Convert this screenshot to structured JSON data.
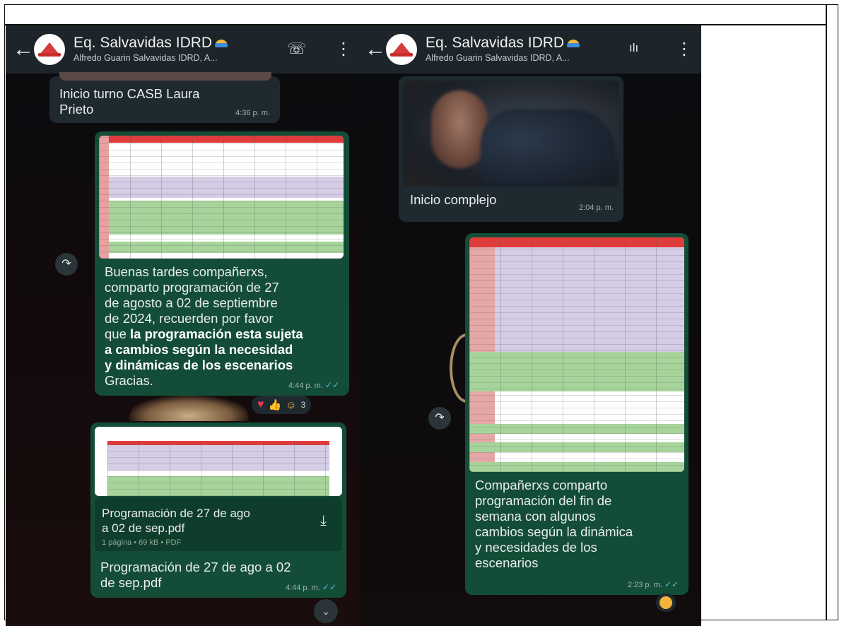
{
  "chat": {
    "group_name": "Eq. Salvavidas IDRD",
    "group_subtitle": "Alfredo Guarin Salvavidas IDRD, A..."
  },
  "left_panel": {
    "msg_turno": {
      "text_line1": "Inicio turno CASB Laura",
      "text_line2": "Prieto",
      "time": "4:36 p. m."
    },
    "msg_programacion": {
      "line1": "Buenas tardes compañerxs,",
      "line2": "comparto programación de 27",
      "line3": "de agosto a 02 de septiembre",
      "line4": "de 2024, recuerden por favor",
      "line5_plain": "que ",
      "line5_bold": "la programación esta sujeta",
      "line6_bold": "a cambios según la necesidad",
      "line7_bold": "y dinámicas de los escenarios",
      "line8": "Gracias.",
      "time": "4:44 p. m."
    },
    "reactions": {
      "count": "3"
    },
    "msg_pdf": {
      "file_name_line1": "Programación de 27 de ago",
      "file_name_line2": "a 02 de sep.pdf",
      "file_meta": "1 página • 69 kB • PDF",
      "caption_line1": "Programación de 27 de ago a 02",
      "caption_line2": "de sep.pdf",
      "time": "4:44 p. m."
    }
  },
  "right_panel": {
    "msg_complejo": {
      "text": "Inicio complejo",
      "time": "2:04 p. m."
    },
    "msg_fin_semana": {
      "line1": "Compañerxs comparto",
      "line2": "programación del fin de",
      "line3": "semana con algunos",
      "line4": "cambios según la dinámica",
      "line5": "y necesidades de los",
      "line6": "escenarios",
      "time": "2:23 p. m."
    }
  },
  "icons": {
    "back": "←",
    "add_call": "☏",
    "menu": "⋮",
    "voice": "ılı",
    "forward": "↷",
    "download": "⤓",
    "scroll_down": "⌄",
    "ticks": "✓✓"
  },
  "colors": {
    "header_bg": "#1d252a",
    "incoming_bubble": "#1f2a30",
    "outgoing_bubble": "#144d37",
    "read_ticks": "#53bdeb"
  }
}
